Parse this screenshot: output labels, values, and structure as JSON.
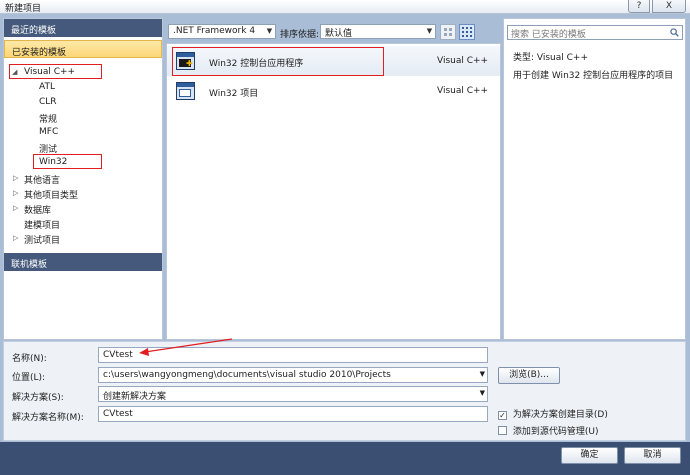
{
  "window": {
    "title": "新建项目",
    "help_label": "?",
    "close_label": "X"
  },
  "left_panel": {
    "recent_header": "最近的模板",
    "installed_header": "已安装的模板",
    "online_header": "联机模板",
    "tree": [
      {
        "label": "Visual C++",
        "expanded": true
      },
      {
        "label": "ATL"
      },
      {
        "label": "CLR"
      },
      {
        "label": "常规"
      },
      {
        "label": "MFC"
      },
      {
        "label": "测试"
      },
      {
        "label": "Win32"
      },
      {
        "label": "其他语言"
      },
      {
        "label": "其他项目类型"
      },
      {
        "label": "数据库"
      },
      {
        "label": "建模项目"
      },
      {
        "label": "测试项目"
      }
    ]
  },
  "toolbar": {
    "framework": ".NET Framework 4",
    "sort_label": "排序依据:",
    "sort_value": "默认值"
  },
  "templates": [
    {
      "name": "Win32 控制台应用程序",
      "language": "Visual C++",
      "selected": true
    },
    {
      "name": "Win32 项目",
      "language": "Visual C++",
      "selected": false
    }
  ],
  "right_panel": {
    "search_placeholder": "搜索 已安装的模板",
    "type_line": "类型:  Visual C++",
    "description": "用于创建 Win32 控制台应用程序的项目"
  },
  "form": {
    "name_label": "名称(N):",
    "name_value": "CVtest",
    "location_label": "位置(L):",
    "location_value": "c:\\users\\wangyongmeng\\documents\\visual studio 2010\\Projects",
    "browse_label": "浏览(B)...",
    "solution_label": "解决方案(S):",
    "solution_value": "创建新解决方案",
    "solution_name_label": "解决方案名称(M):",
    "solution_name_value": "CVtest",
    "create_dir_label": "为解决方案创建目录(D)",
    "create_dir_checked": true,
    "source_control_label": "添加到源代码管理(U)",
    "source_control_checked": false,
    "ok_label": "确定",
    "cancel_label": "取消"
  },
  "colors": {
    "annotation": "#e02020",
    "panel_header": "#44597b",
    "selection": "#fbd676"
  }
}
